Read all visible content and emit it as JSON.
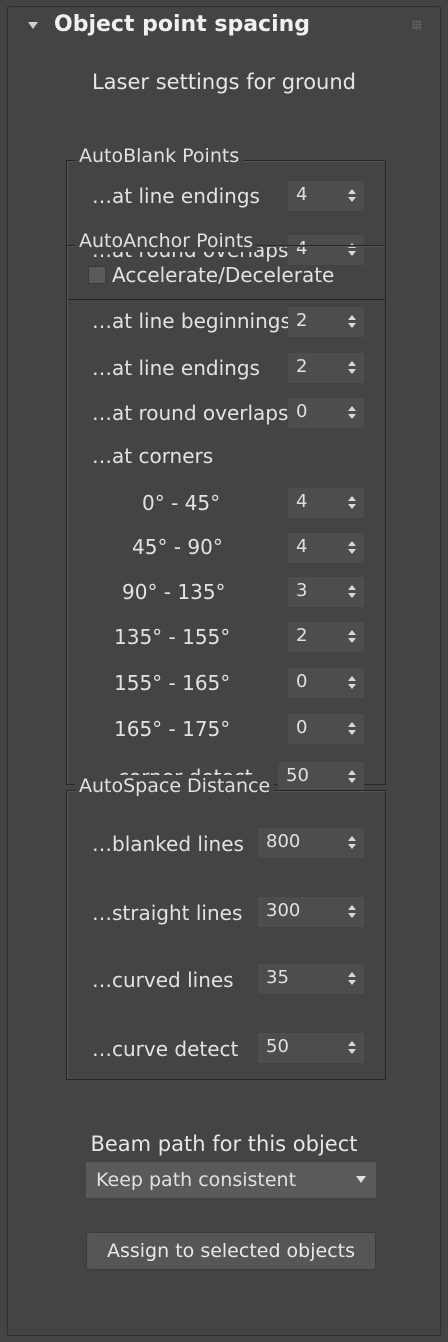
{
  "rollout": {
    "title": "Object point spacing",
    "subtitle": "Laser settings for ground"
  },
  "autoblank": {
    "title": "AutoBlank Points",
    "rows": [
      {
        "label": "…at line endings",
        "value": "4"
      },
      {
        "label": "…at round overlaps",
        "value": "4"
      }
    ]
  },
  "autoanchor": {
    "title": "AutoAnchor Points",
    "accelerate_label": "Accelerate/Decelerate",
    "accelerate_checked": false,
    "rows": [
      {
        "label": "…at line beginnings",
        "value": "2"
      },
      {
        "label": "…at line endings",
        "value": "2"
      },
      {
        "label": "…at round overlaps",
        "value": "0"
      }
    ],
    "corners_label": "…at corners",
    "corners": [
      {
        "label": "0° -   45°",
        "value": "4"
      },
      {
        "label": "45° -   90°",
        "value": "4"
      },
      {
        "label": "90° - 135°",
        "value": "3"
      },
      {
        "label": "135° - 155°",
        "value": "2"
      },
      {
        "label": "155° - 165°",
        "value": "0"
      },
      {
        "label": "165° - 175°",
        "value": "0"
      }
    ],
    "corner_detect": {
      "label": "…corner detect",
      "value": "50"
    }
  },
  "autospace": {
    "title": "AutoSpace Distance",
    "rows": [
      {
        "label": "…blanked lines",
        "value": "800"
      },
      {
        "label": "…straight lines",
        "value": "300"
      },
      {
        "label": "…curved lines",
        "value": "35"
      },
      {
        "label": "…curve detect",
        "value": "50"
      }
    ]
  },
  "beam_path": {
    "label": "Beam path for this object",
    "selected": "Keep path consistent"
  },
  "assign_button": "Assign to selected objects"
}
